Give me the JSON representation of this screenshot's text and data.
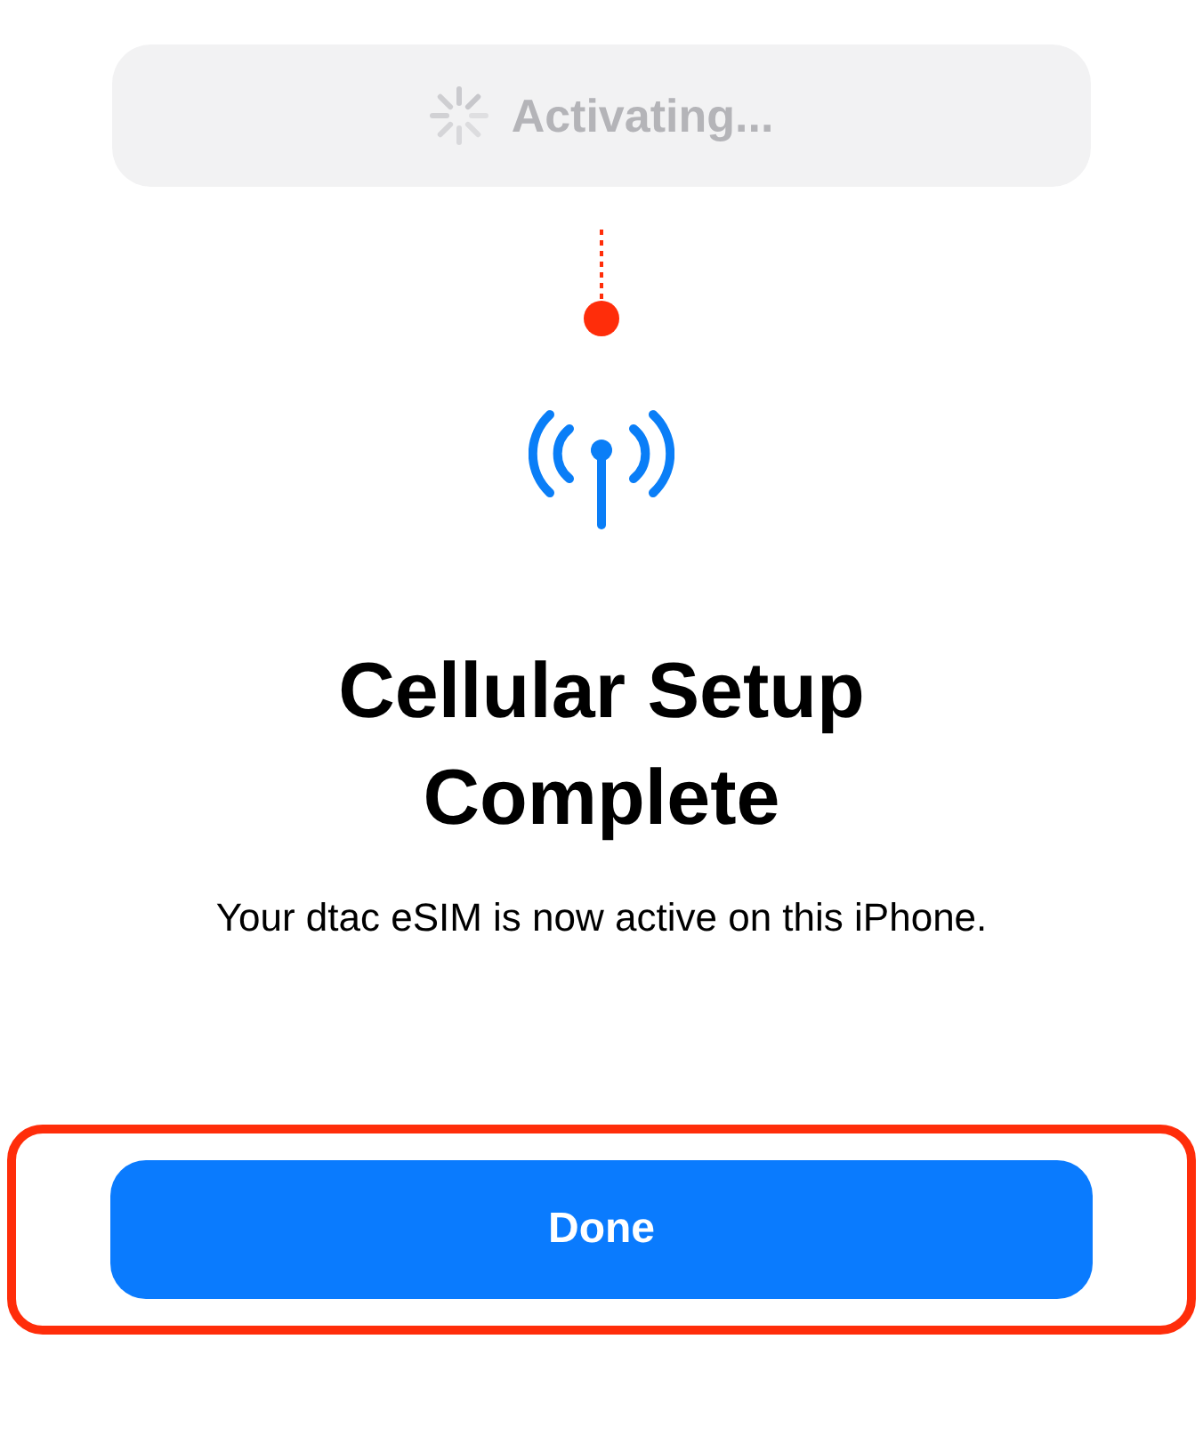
{
  "status_button": {
    "label": "Activating...",
    "disabled": true
  },
  "title": "Cellular Setup Complete",
  "message": "Your dtac eSIM is now active on this iPhone.",
  "done_button": {
    "label": "Done",
    "highlighted": true
  }
}
